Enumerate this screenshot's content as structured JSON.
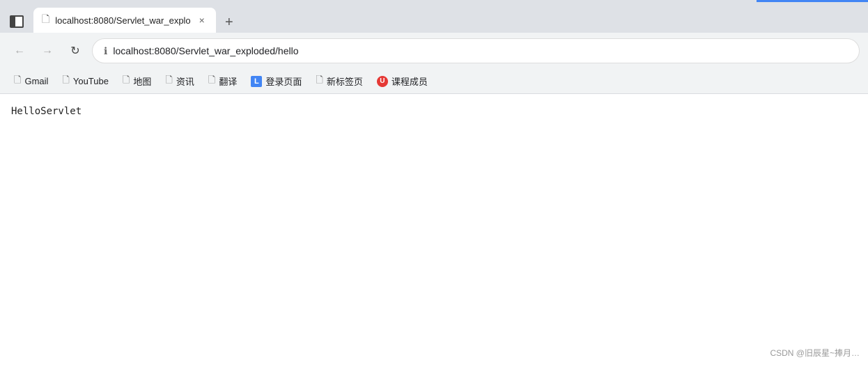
{
  "browser": {
    "tab": {
      "title": "localhost:8080/Servlet_war_explo",
      "close_label": "×",
      "new_tab_label": "+"
    },
    "address": {
      "url": "localhost:8080/Servlet_war_exploded/hello",
      "info_icon": "ℹ"
    },
    "nav": {
      "back": "←",
      "forward": "→",
      "refresh": "↻"
    },
    "bookmarks": [
      {
        "id": "gmail",
        "label": "Gmail",
        "icon_type": "page"
      },
      {
        "id": "youtube",
        "label": "YouTube",
        "icon_type": "page"
      },
      {
        "id": "maps",
        "label": "地图",
        "icon_type": "page"
      },
      {
        "id": "news",
        "label": "资讯",
        "icon_type": "page"
      },
      {
        "id": "translate",
        "label": "翻译",
        "icon_type": "page"
      },
      {
        "id": "login",
        "label": "登录页面",
        "icon_type": "L"
      },
      {
        "id": "newtab",
        "label": "新标签页",
        "icon_type": "page"
      },
      {
        "id": "course",
        "label": "课程成员",
        "icon_type": "U"
      }
    ]
  },
  "page": {
    "content": "HelloServlet"
  },
  "watermark": {
    "text": "CSDN @旧辰星~捧月…"
  }
}
